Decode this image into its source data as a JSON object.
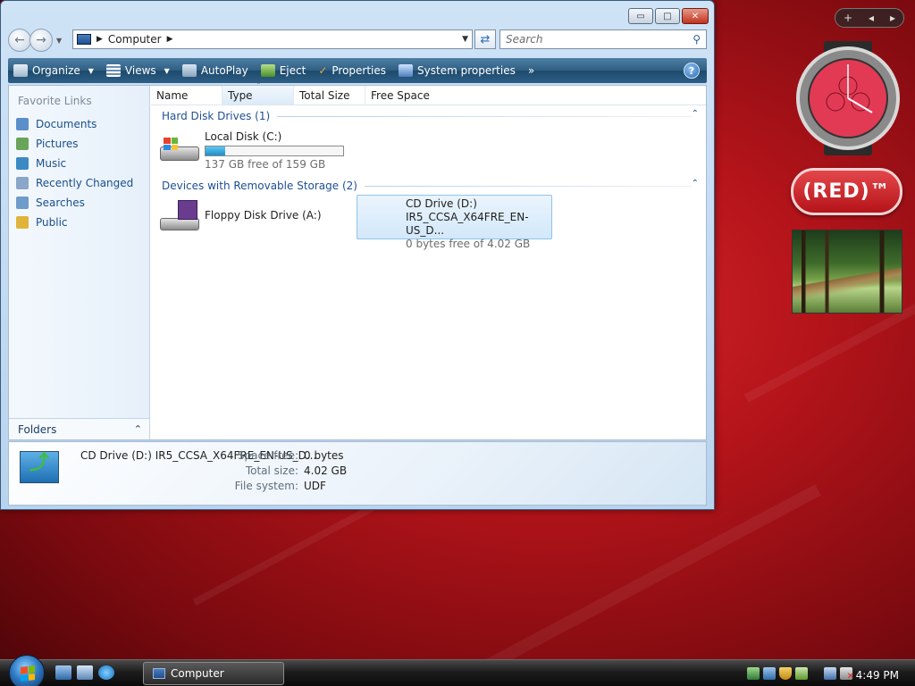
{
  "window": {
    "title_buttons": {
      "minimize": "▭",
      "maximize": "□",
      "close": "✕"
    },
    "address": {
      "crumbs": [
        "Computer"
      ]
    },
    "search": {
      "placeholder": "Search"
    },
    "toolbar": {
      "items": [
        {
          "label": "Organize",
          "icon": "organize-icon",
          "caret": true
        },
        {
          "label": "Views",
          "icon": "views-icon",
          "caret": true
        },
        {
          "label": "AutoPlay",
          "icon": "autoplay-icon",
          "caret": false
        },
        {
          "label": "Eject",
          "icon": "eject-icon",
          "caret": false
        },
        {
          "label": "Properties",
          "icon": "properties-icon",
          "caret": false
        },
        {
          "label": "System properties",
          "icon": "system-properties-icon",
          "caret": false
        }
      ],
      "more": "»",
      "help": "?"
    },
    "nav_pane": {
      "header": "Favorite Links",
      "items": [
        {
          "label": "Documents",
          "color": "#5b8fc9"
        },
        {
          "label": "Pictures",
          "color": "#6aa35a"
        },
        {
          "label": "Music",
          "color": "#3c8ac4"
        },
        {
          "label": "Recently Changed",
          "color": "#8aa6c8"
        },
        {
          "label": "Searches",
          "color": "#6f9cc9"
        },
        {
          "label": "Public",
          "color": "#e0b43a"
        }
      ],
      "folders": "Folders"
    },
    "columns": [
      "Name",
      "Type",
      "Total Size",
      "Free Space"
    ],
    "groups": {
      "hard_disks": {
        "title": "Hard Disk Drives (1)",
        "drives": [
          {
            "name": "Local Disk (C:)",
            "free_text": "137 GB free of 159 GB",
            "used_fraction": 0.14
          }
        ]
      },
      "removable": {
        "title": "Devices with Removable Storage (2)",
        "drives": [
          {
            "name": "Floppy Disk Drive (A:)"
          },
          {
            "name": "CD Drive (D:)",
            "label": "IR5_CCSA_X64FRE_EN-US_D...",
            "free_text": "0 bytes free of 4.02 GB"
          }
        ]
      }
    },
    "details": {
      "title": "CD Drive (D:) IR5_CCSA_X64FRE_EN-US_D...",
      "space_free_label": "Space free:",
      "space_free": "0 bytes",
      "total_size_label": "Total size:",
      "total_size": "4.02 GB",
      "file_system_label": "File system:",
      "file_system": "UDF"
    }
  },
  "gadgets": {
    "toolbar": {
      "add": "+",
      "prev": "◂",
      "next": "▸"
    },
    "red_badge": "(RED)™",
    "accent": "#c81e24"
  },
  "taskbar": {
    "task": "Computer",
    "clock": "4:49 PM"
  }
}
